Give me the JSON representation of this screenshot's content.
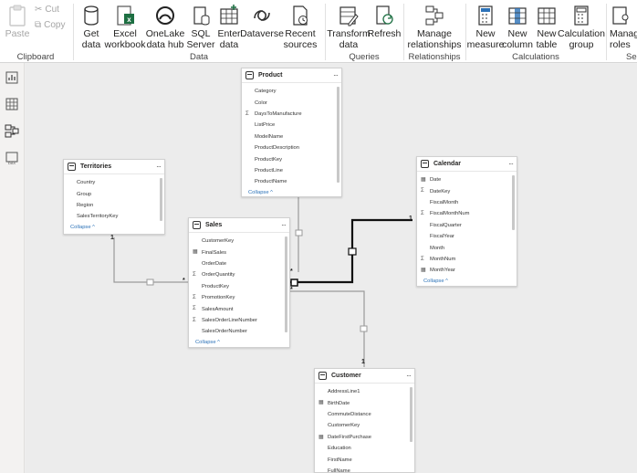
{
  "ribbon": {
    "clipboard": {
      "paste": "Paste",
      "cut": "Cut",
      "copy": "Copy",
      "label": "Clipboard"
    },
    "data": {
      "get_data": [
        "Get",
        "data"
      ],
      "excel": [
        "Excel",
        "workbook"
      ],
      "onelake": [
        "OneLake",
        "data hub"
      ],
      "sql": [
        "SQL",
        "Server"
      ],
      "enter": [
        "Enter",
        "data"
      ],
      "dataverse": [
        "Dataverse",
        ""
      ],
      "recent": [
        "Recent",
        "sources"
      ],
      "label": "Data"
    },
    "queries": {
      "transform": [
        "Transform",
        "data"
      ],
      "refresh": [
        "Refresh",
        ""
      ],
      "label": "Queries"
    },
    "relationships": {
      "manage": [
        "Manage",
        "relationships"
      ],
      "label": "Relationships"
    },
    "calculations": {
      "new_measure": [
        "New",
        "measure"
      ],
      "new_column": [
        "New",
        "column"
      ],
      "new_table": [
        "New",
        "table"
      ],
      "calc_group": [
        "Calculation",
        "group"
      ],
      "label": "Calculations"
    },
    "security": {
      "manage_roles": [
        "Manag",
        "roles"
      ],
      "label": "Se"
    }
  },
  "tables": {
    "product": {
      "title": "Product",
      "fields": [
        {
          "name": "Category",
          "icon": ""
        },
        {
          "name": "Color",
          "icon": ""
        },
        {
          "name": "DaysToManufacture",
          "icon": "Σ"
        },
        {
          "name": "ListPrice",
          "icon": ""
        },
        {
          "name": "ModelName",
          "icon": ""
        },
        {
          "name": "ProductDescription",
          "icon": ""
        },
        {
          "name": "ProductKey",
          "icon": ""
        },
        {
          "name": "ProductLine",
          "icon": ""
        },
        {
          "name": "ProductName",
          "icon": ""
        }
      ],
      "collapse": "Collapse ^"
    },
    "territories": {
      "title": "Territories",
      "fields": [
        {
          "name": "Country",
          "icon": ""
        },
        {
          "name": "Group",
          "icon": ""
        },
        {
          "name": "Region",
          "icon": ""
        },
        {
          "name": "SalesTerritoryKey",
          "icon": ""
        }
      ],
      "collapse": "Collapse ^"
    },
    "sales": {
      "title": "Sales",
      "fields": [
        {
          "name": "CustomerKey",
          "icon": ""
        },
        {
          "name": "FinalSales",
          "icon": "▦"
        },
        {
          "name": "OrderDate",
          "icon": ""
        },
        {
          "name": "OrderQuantity",
          "icon": "Σ"
        },
        {
          "name": "ProductKey",
          "icon": ""
        },
        {
          "name": "PromotionKey",
          "icon": "Σ"
        },
        {
          "name": "SalesAmount",
          "icon": "Σ"
        },
        {
          "name": "SalesOrderLineNumber",
          "icon": "Σ"
        },
        {
          "name": "SalesOrderNumber",
          "icon": ""
        }
      ],
      "collapse": "Collapse ^"
    },
    "calendar": {
      "title": "Calendar",
      "fields": [
        {
          "name": "Date",
          "icon": "▦"
        },
        {
          "name": "DateKey",
          "icon": "Σ"
        },
        {
          "name": "FiscalMonth",
          "icon": ""
        },
        {
          "name": "FiscalMonthNum",
          "icon": "Σ"
        },
        {
          "name": "FiscalQuarter",
          "icon": ""
        },
        {
          "name": "FiscalYear",
          "icon": ""
        },
        {
          "name": "Month",
          "icon": ""
        },
        {
          "name": "MonthNum",
          "icon": "Σ"
        },
        {
          "name": "MonthYear",
          "icon": "▦"
        }
      ],
      "collapse": "Collapse ^"
    },
    "customer": {
      "title": "Customer",
      "fields": [
        {
          "name": "AddressLine1",
          "icon": ""
        },
        {
          "name": "BirthDate",
          "icon": "▦"
        },
        {
          "name": "CommuteDistance",
          "icon": ""
        },
        {
          "name": "CustomerKey",
          "icon": ""
        },
        {
          "name": "DateFirstPurchase",
          "icon": "▦"
        },
        {
          "name": "Education",
          "icon": ""
        },
        {
          "name": "FirstName",
          "icon": ""
        },
        {
          "name": "FullName",
          "icon": ""
        }
      ],
      "collapse": ""
    }
  },
  "cardinality": {
    "one": "1",
    "many": "*"
  },
  "more": "···",
  "colors": {
    "excel": "#1d6f42",
    "accent": "#2c72b8",
    "active_line": "#111111",
    "inactive_line": "#9a9a9a"
  }
}
